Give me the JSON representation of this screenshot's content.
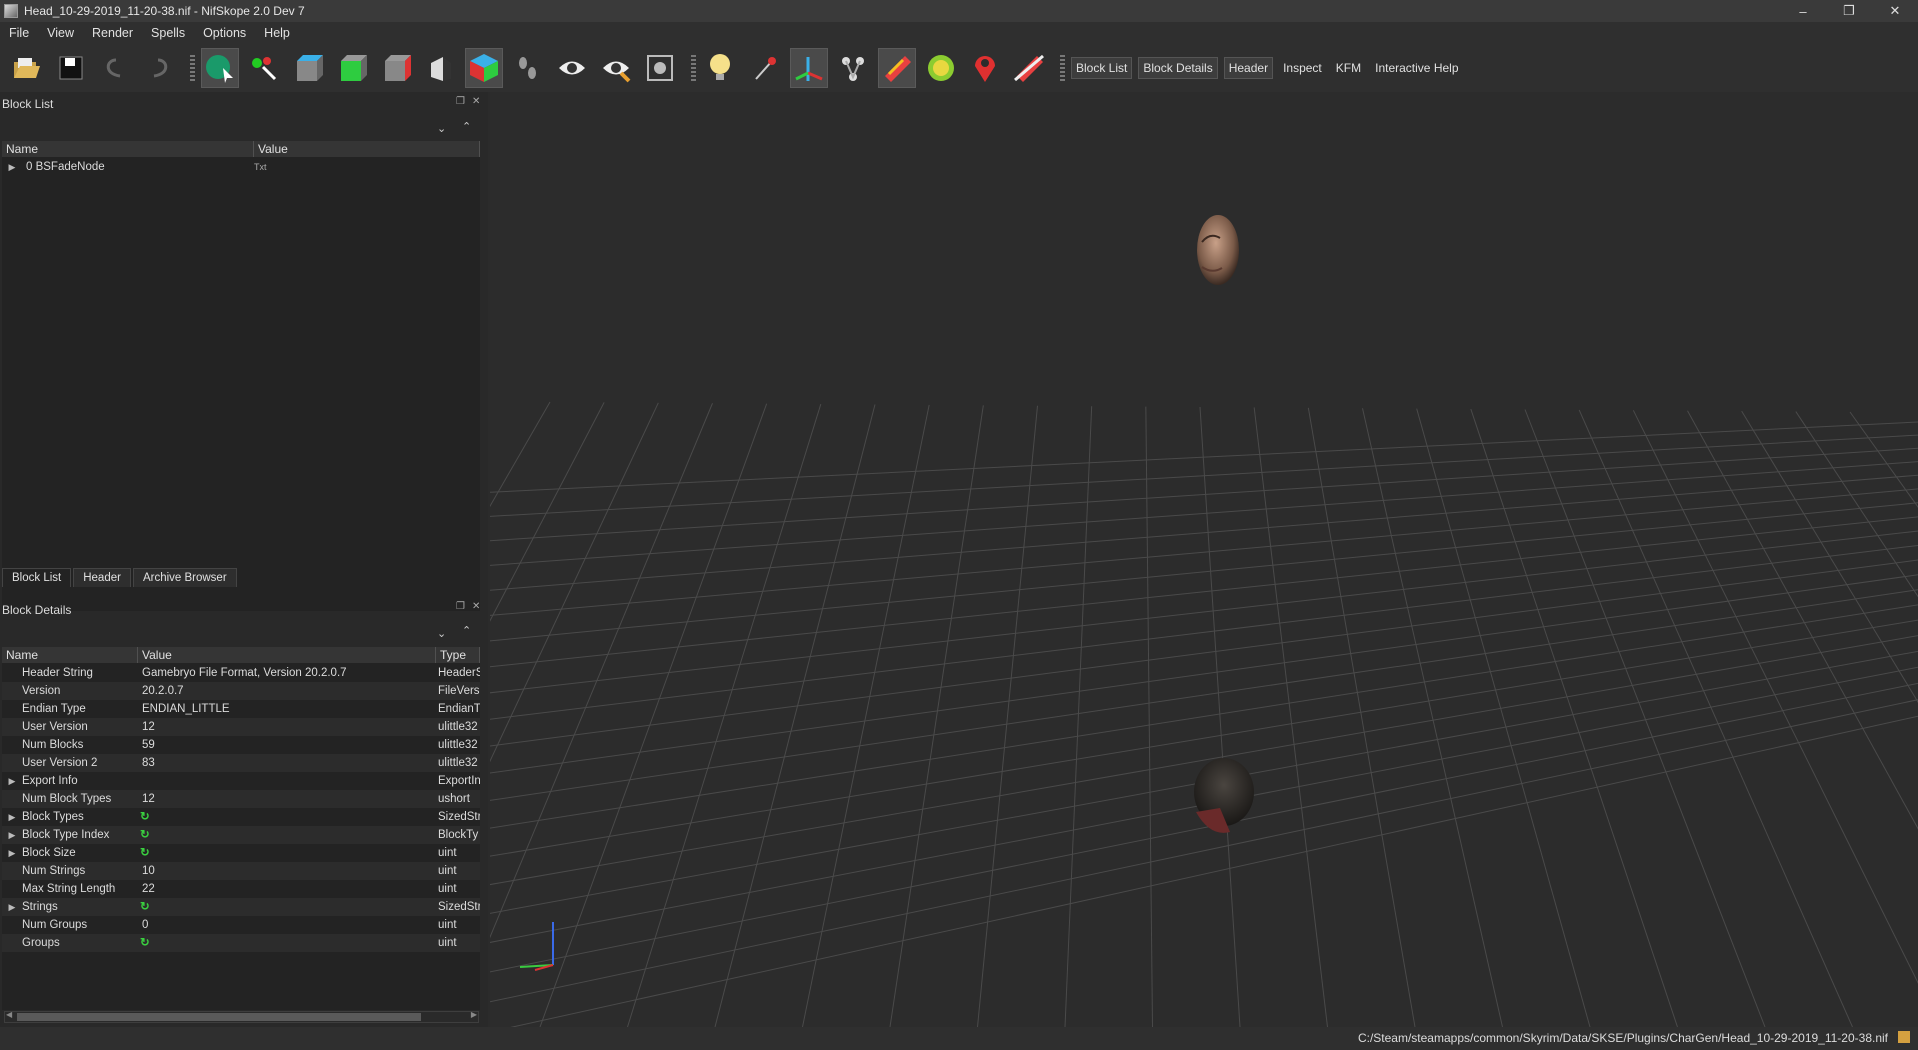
{
  "window": {
    "title": "Head_10-29-2019_11-20-38.nif - NifSkope 2.0 Dev 7",
    "minimize": "–",
    "maximize": "❐",
    "close": "✕"
  },
  "menu": [
    "File",
    "View",
    "Render",
    "Spells",
    "Options",
    "Help"
  ],
  "toolbar": {
    "text_buttons": [
      "Block List",
      "Block Details",
      "Header",
      "Inspect",
      "KFM",
      "Interactive Help"
    ]
  },
  "block_list": {
    "title": "Block List",
    "columns": [
      "Name",
      "Value"
    ],
    "rows": [
      {
        "name": "0 BSFadeNode",
        "value": "Txt"
      }
    ]
  },
  "left_tabs": [
    "Block List",
    "Header",
    "Archive Browser"
  ],
  "block_details": {
    "title": "Block Details",
    "columns": [
      "Name",
      "Value",
      "Type"
    ],
    "rows": [
      {
        "name": "Header String",
        "value": "Gamebryo File Format, Version 20.2.0.7",
        "type": "HeaderS",
        "expand": false
      },
      {
        "name": "Version",
        "value": "20.2.0.7",
        "type": "FileVersi",
        "expand": false
      },
      {
        "name": "Endian Type",
        "value": "ENDIAN_LITTLE",
        "type": "EndianT",
        "expand": false
      },
      {
        "name": "User Version",
        "value": "12",
        "type": "ulittle32",
        "expand": false
      },
      {
        "name": "Num Blocks",
        "value": "59",
        "type": "ulittle32",
        "expand": false
      },
      {
        "name": "User Version 2",
        "value": "83",
        "type": "ulittle32",
        "expand": false
      },
      {
        "name": "Export Info",
        "value": "",
        "type": "ExportIn",
        "expand": true
      },
      {
        "name": "Num Block Types",
        "value": "12",
        "type": "ushort",
        "expand": false
      },
      {
        "name": "Block Types",
        "value": "",
        "type": "SizedStri",
        "expand": true,
        "icon": true
      },
      {
        "name": "Block Type Index",
        "value": "",
        "type": "BlockTy",
        "expand": true,
        "icon": true
      },
      {
        "name": "Block Size",
        "value": "",
        "type": "uint",
        "expand": true,
        "icon": true
      },
      {
        "name": "Num Strings",
        "value": "10",
        "type": "uint",
        "expand": false
      },
      {
        "name": "Max String Length",
        "value": "22",
        "type": "uint",
        "expand": false
      },
      {
        "name": "Strings",
        "value": "",
        "type": "SizedStri",
        "expand": true,
        "icon": true
      },
      {
        "name": "Num Groups",
        "value": "0",
        "type": "uint",
        "expand": false
      },
      {
        "name": "Groups",
        "value": "",
        "type": "uint",
        "expand": false,
        "icon": true
      }
    ]
  },
  "status": {
    "path": "C:/Steam/steamapps/common/Skyrim/Data/SKSE/Plugins/CharGen/Head_10-29-2019_11-20-38.nif"
  }
}
